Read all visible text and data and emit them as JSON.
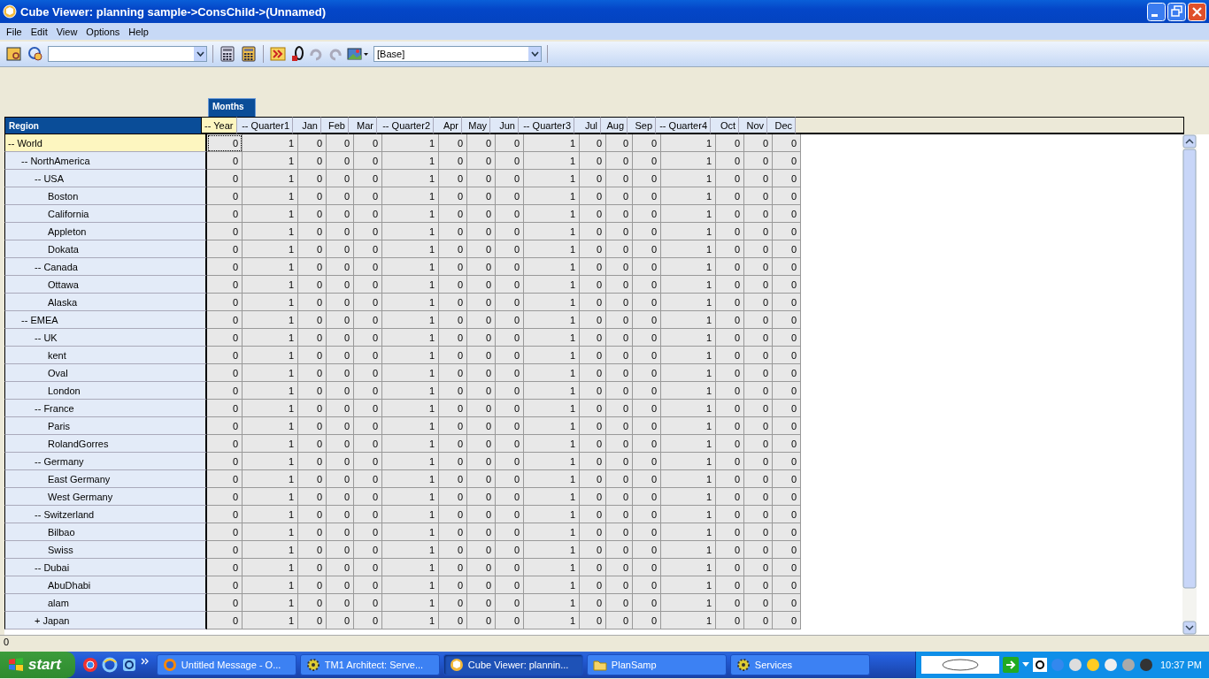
{
  "window": {
    "title": "Cube Viewer: planning sample->ConsChild->(Unnamed)"
  },
  "menu": [
    "File",
    "Edit",
    "View",
    "Options",
    "Help"
  ],
  "toolbar": {
    "subset_select": {
      "value": "[Base]"
    }
  },
  "grid": {
    "column_dimension": "Months",
    "row_dimension": "Region",
    "columns": [
      {
        "label": "-- Year",
        "selected": true
      },
      {
        "label": "-- Quarter1",
        "selected": false
      },
      {
        "label": "Jan",
        "selected": false
      },
      {
        "label": "Feb",
        "selected": false
      },
      {
        "label": "Mar",
        "selected": false
      },
      {
        "label": "-- Quarter2",
        "selected": false
      },
      {
        "label": "Apr",
        "selected": false
      },
      {
        "label": "May",
        "selected": false
      },
      {
        "label": "Jun",
        "selected": false
      },
      {
        "label": "-- Quarter3",
        "selected": false
      },
      {
        "label": "Jul",
        "selected": false
      },
      {
        "label": "Aug",
        "selected": false
      },
      {
        "label": "Sep",
        "selected": false
      },
      {
        "label": "-- Quarter4",
        "selected": false
      },
      {
        "label": "Oct",
        "selected": false
      },
      {
        "label": "Nov",
        "selected": false
      },
      {
        "label": "Dec",
        "selected": false
      }
    ],
    "rows": [
      {
        "label": "-- World",
        "selected": true,
        "values": [
          "0",
          "1",
          "0",
          "0",
          "0",
          "1",
          "0",
          "0",
          "0",
          "1",
          "0",
          "0",
          "0",
          "1",
          "0",
          "0",
          "0"
        ],
        "children": [
          {
            "label": "-- NorthAmerica",
            "selected": false,
            "values": [
              "0",
              "1",
              "0",
              "0",
              "0",
              "1",
              "0",
              "0",
              "0",
              "1",
              "0",
              "0",
              "0",
              "1",
              "0",
              "0",
              "0"
            ],
            "children": [
              {
                "label": "-- USA",
                "selected": false,
                "values": [
                  "0",
                  "1",
                  "0",
                  "0",
                  "0",
                  "1",
                  "0",
                  "0",
                  "0",
                  "1",
                  "0",
                  "0",
                  "0",
                  "1",
                  "0",
                  "0",
                  "0"
                ],
                "children": [
                  {
                    "label": "Boston",
                    "selected": false,
                    "values": [
                      "0",
                      "1",
                      "0",
                      "0",
                      "0",
                      "1",
                      "0",
                      "0",
                      "0",
                      "1",
                      "0",
                      "0",
                      "0",
                      "1",
                      "0",
                      "0",
                      "0"
                    ]
                  },
                  {
                    "label": "California",
                    "selected": false,
                    "values": [
                      "0",
                      "1",
                      "0",
                      "0",
                      "0",
                      "1",
                      "0",
                      "0",
                      "0",
                      "1",
                      "0",
                      "0",
                      "0",
                      "1",
                      "0",
                      "0",
                      "0"
                    ]
                  },
                  {
                    "label": "Appleton",
                    "selected": false,
                    "values": [
                      "0",
                      "1",
                      "0",
                      "0",
                      "0",
                      "1",
                      "0",
                      "0",
                      "0",
                      "1",
                      "0",
                      "0",
                      "0",
                      "1",
                      "0",
                      "0",
                      "0"
                    ]
                  },
                  {
                    "label": "Dokata",
                    "selected": false,
                    "values": [
                      "0",
                      "1",
                      "0",
                      "0",
                      "0",
                      "1",
                      "0",
                      "0",
                      "0",
                      "1",
                      "0",
                      "0",
                      "0",
                      "1",
                      "0",
                      "0",
                      "0"
                    ]
                  }
                ]
              },
              {
                "label": "-- Canada",
                "selected": false,
                "values": [
                  "0",
                  "1",
                  "0",
                  "0",
                  "0",
                  "1",
                  "0",
                  "0",
                  "0",
                  "1",
                  "0",
                  "0",
                  "0",
                  "1",
                  "0",
                  "0",
                  "0"
                ],
                "children": [
                  {
                    "label": "Ottawa",
                    "selected": false,
                    "values": [
                      "0",
                      "1",
                      "0",
                      "0",
                      "0",
                      "1",
                      "0",
                      "0",
                      "0",
                      "1",
                      "0",
                      "0",
                      "0",
                      "1",
                      "0",
                      "0",
                      "0"
                    ]
                  },
                  {
                    "label": "Alaska",
                    "selected": false,
                    "values": [
                      "0",
                      "1",
                      "0",
                      "0",
                      "0",
                      "1",
                      "0",
                      "0",
                      "0",
                      "1",
                      "0",
                      "0",
                      "0",
                      "1",
                      "0",
                      "0",
                      "0"
                    ]
                  }
                ]
              }
            ]
          },
          {
            "label": "-- EMEA",
            "selected": false,
            "values": [
              "0",
              "1",
              "0",
              "0",
              "0",
              "1",
              "0",
              "0",
              "0",
              "1",
              "0",
              "0",
              "0",
              "1",
              "0",
              "0",
              "0"
            ],
            "children": [
              {
                "label": "-- UK",
                "selected": false,
                "values": [
                  "0",
                  "1",
                  "0",
                  "0",
                  "0",
                  "1",
                  "0",
                  "0",
                  "0",
                  "1",
                  "0",
                  "0",
                  "0",
                  "1",
                  "0",
                  "0",
                  "0"
                ],
                "children": [
                  {
                    "label": "kent",
                    "selected": false,
                    "values": [
                      "0",
                      "1",
                      "0",
                      "0",
                      "0",
                      "1",
                      "0",
                      "0",
                      "0",
                      "1",
                      "0",
                      "0",
                      "0",
                      "1",
                      "0",
                      "0",
                      "0"
                    ]
                  },
                  {
                    "label": "Oval",
                    "selected": false,
                    "values": [
                      "0",
                      "1",
                      "0",
                      "0",
                      "0",
                      "1",
                      "0",
                      "0",
                      "0",
                      "1",
                      "0",
                      "0",
                      "0",
                      "1",
                      "0",
                      "0",
                      "0"
                    ]
                  },
                  {
                    "label": "London",
                    "selected": false,
                    "values": [
                      "0",
                      "1",
                      "0",
                      "0",
                      "0",
                      "1",
                      "0",
                      "0",
                      "0",
                      "1",
                      "0",
                      "0",
                      "0",
                      "1",
                      "0",
                      "0",
                      "0"
                    ]
                  }
                ]
              },
              {
                "label": "-- France",
                "selected": false,
                "values": [
                  "0",
                  "1",
                  "0",
                  "0",
                  "0",
                  "1",
                  "0",
                  "0",
                  "0",
                  "1",
                  "0",
                  "0",
                  "0",
                  "1",
                  "0",
                  "0",
                  "0"
                ],
                "children": [
                  {
                    "label": "Paris",
                    "selected": false,
                    "values": [
                      "0",
                      "1",
                      "0",
                      "0",
                      "0",
                      "1",
                      "0",
                      "0",
                      "0",
                      "1",
                      "0",
                      "0",
                      "0",
                      "1",
                      "0",
                      "0",
                      "0"
                    ]
                  },
                  {
                    "label": "RolandGorres",
                    "selected": false,
                    "values": [
                      "0",
                      "1",
                      "0",
                      "0",
                      "0",
                      "1",
                      "0",
                      "0",
                      "0",
                      "1",
                      "0",
                      "0",
                      "0",
                      "1",
                      "0",
                      "0",
                      "0"
                    ]
                  }
                ]
              },
              {
                "label": "-- Germany",
                "selected": false,
                "values": [
                  "0",
                  "1",
                  "0",
                  "0",
                  "0",
                  "1",
                  "0",
                  "0",
                  "0",
                  "1",
                  "0",
                  "0",
                  "0",
                  "1",
                  "0",
                  "0",
                  "0"
                ],
                "children": [
                  {
                    "label": "East Germany",
                    "selected": false,
                    "values": [
                      "0",
                      "1",
                      "0",
                      "0",
                      "0",
                      "1",
                      "0",
                      "0",
                      "0",
                      "1",
                      "0",
                      "0",
                      "0",
                      "1",
                      "0",
                      "0",
                      "0"
                    ]
                  },
                  {
                    "label": "West Germany",
                    "selected": false,
                    "values": [
                      "0",
                      "1",
                      "0",
                      "0",
                      "0",
                      "1",
                      "0",
                      "0",
                      "0",
                      "1",
                      "0",
                      "0",
                      "0",
                      "1",
                      "0",
                      "0",
                      "0"
                    ]
                  }
                ]
              },
              {
                "label": "-- Switzerland",
                "selected": false,
                "values": [
                  "0",
                  "1",
                  "0",
                  "0",
                  "0",
                  "1",
                  "0",
                  "0",
                  "0",
                  "1",
                  "0",
                  "0",
                  "0",
                  "1",
                  "0",
                  "0",
                  "0"
                ],
                "children": [
                  {
                    "label": "Bilbao",
                    "selected": false,
                    "values": [
                      "0",
                      "1",
                      "0",
                      "0",
                      "0",
                      "1",
                      "0",
                      "0",
                      "0",
                      "1",
                      "0",
                      "0",
                      "0",
                      "1",
                      "0",
                      "0",
                      "0"
                    ]
                  },
                  {
                    "label": "Swiss",
                    "selected": false,
                    "values": [
                      "0",
                      "1",
                      "0",
                      "0",
                      "0",
                      "1",
                      "0",
                      "0",
                      "0",
                      "1",
                      "0",
                      "0",
                      "0",
                      "1",
                      "0",
                      "0",
                      "0"
                    ]
                  }
                ]
              },
              {
                "label": "-- Dubai",
                "selected": false,
                "values": [
                  "0",
                  "1",
                  "0",
                  "0",
                  "0",
                  "1",
                  "0",
                  "0",
                  "0",
                  "1",
                  "0",
                  "0",
                  "0",
                  "1",
                  "0",
                  "0",
                  "0"
                ],
                "children": [
                  {
                    "label": "AbuDhabi",
                    "selected": false,
                    "values": [
                      "0",
                      "1",
                      "0",
                      "0",
                      "0",
                      "1",
                      "0",
                      "0",
                      "0",
                      "1",
                      "0",
                      "0",
                      "0",
                      "1",
                      "0",
                      "0",
                      "0"
                    ]
                  },
                  {
                    "label": "alam",
                    "selected": false,
                    "values": [
                      "0",
                      "1",
                      "0",
                      "0",
                      "0",
                      "1",
                      "0",
                      "0",
                      "0",
                      "1",
                      "0",
                      "0",
                      "0",
                      "1",
                      "0",
                      "0",
                      "0"
                    ]
                  }
                ]
              },
              {
                "label": "+ Japan",
                "selected": false,
                "values": [
                  "0",
                  "1",
                  "0",
                  "0",
                  "0",
                  "1",
                  "0",
                  "0",
                  "0",
                  "1",
                  "0",
                  "0",
                  "0",
                  "1",
                  "0",
                  "0",
                  "0"
                ]
              }
            ]
          }
        ]
      }
    ]
  },
  "status_bar": {
    "text": "0"
  },
  "taskbar": {
    "start": "start",
    "tasks": [
      {
        "label": "Untitled Message - O...",
        "kind": "browser",
        "selected": false
      },
      {
        "label": "TM1 Architect: Serve...",
        "kind": "gear",
        "selected": false
      },
      {
        "label": "Cube Viewer: plannin...",
        "kind": "cube",
        "selected": true
      },
      {
        "label": "PlanSamp",
        "kind": "folder",
        "selected": false
      },
      {
        "label": "Services",
        "kind": "gear",
        "selected": false
      }
    ],
    "time": "10:37 PM"
  }
}
